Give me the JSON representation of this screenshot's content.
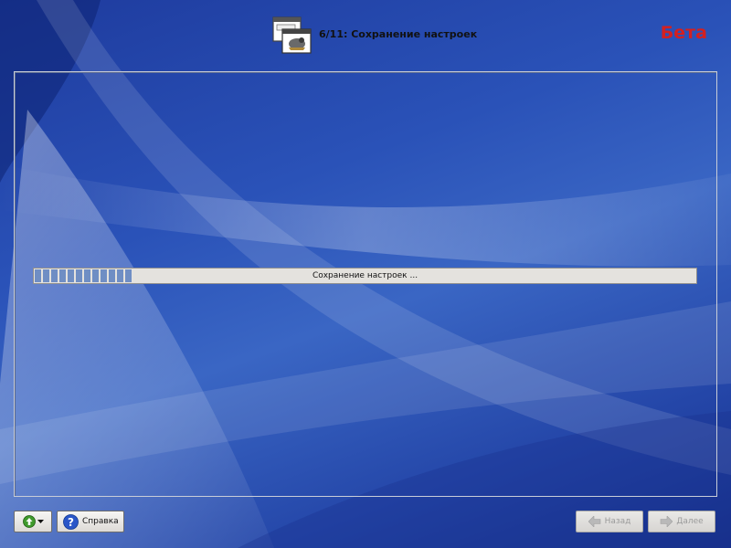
{
  "header": {
    "step_title": "6/11: Сохранение настроек",
    "beta_label": "Бета",
    "icon": "installer-window-icon"
  },
  "progress": {
    "label": "Сохранение настроек ...",
    "fraction": 0.15
  },
  "buttons": {
    "tools_icon": "green-up-arrow-icon",
    "help_label": "Справка",
    "back_label": "Назад",
    "next_label": "Далее"
  },
  "colors": {
    "beta": "#d42020",
    "progress_fill": "#6f8ec4",
    "background": "#2a52b8"
  }
}
